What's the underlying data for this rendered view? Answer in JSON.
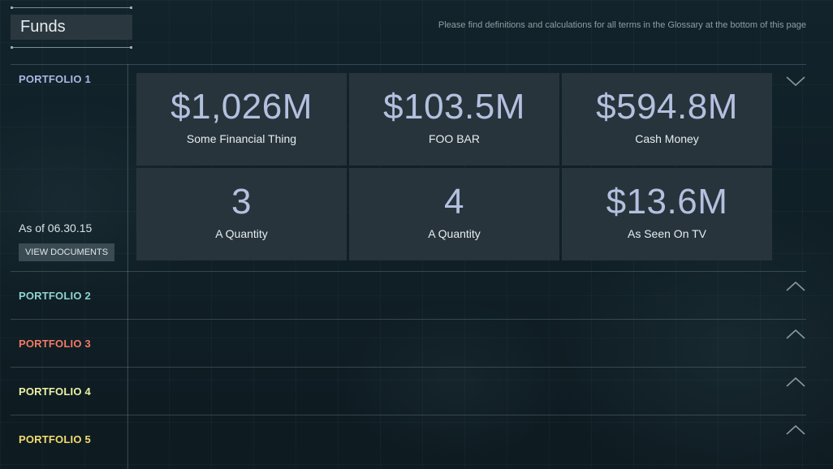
{
  "header": {
    "title": "Funds",
    "glossary_note": "Please find definitions and calculations for all terms in the Glossary at the bottom of this page"
  },
  "portfolios": [
    {
      "name": "PORTFOLIO 1",
      "color": "#a9b7e2",
      "expanded": true,
      "as_of": "As of 06.30.15",
      "view_documents_label": "VIEW DOCUMENTS",
      "metrics": [
        {
          "value": "$1,026M",
          "label": "Some Financial Thing"
        },
        {
          "value": "$103.5M",
          "label": "FOO BAR"
        },
        {
          "value": "$594.8M",
          "label": "Cash Money"
        },
        {
          "value": "3",
          "label": "A Quantity"
        },
        {
          "value": "4",
          "label": "A Quantity"
        },
        {
          "value": "$13.6M",
          "label": "As Seen On TV"
        }
      ]
    },
    {
      "name": "PORTFOLIO 2",
      "color": "#8fd3d2",
      "expanded": false
    },
    {
      "name": "PORTFOLIO 3",
      "color": "#f07b64",
      "expanded": false
    },
    {
      "name": "PORTFOLIO 4",
      "color": "#eef1a4",
      "expanded": false
    },
    {
      "name": "PORTFOLIO 5",
      "color": "#f5db6e",
      "expanded": false
    }
  ],
  "icons": {
    "expanded": "chevron-down-icon",
    "collapsed": "chevron-up-icon"
  }
}
